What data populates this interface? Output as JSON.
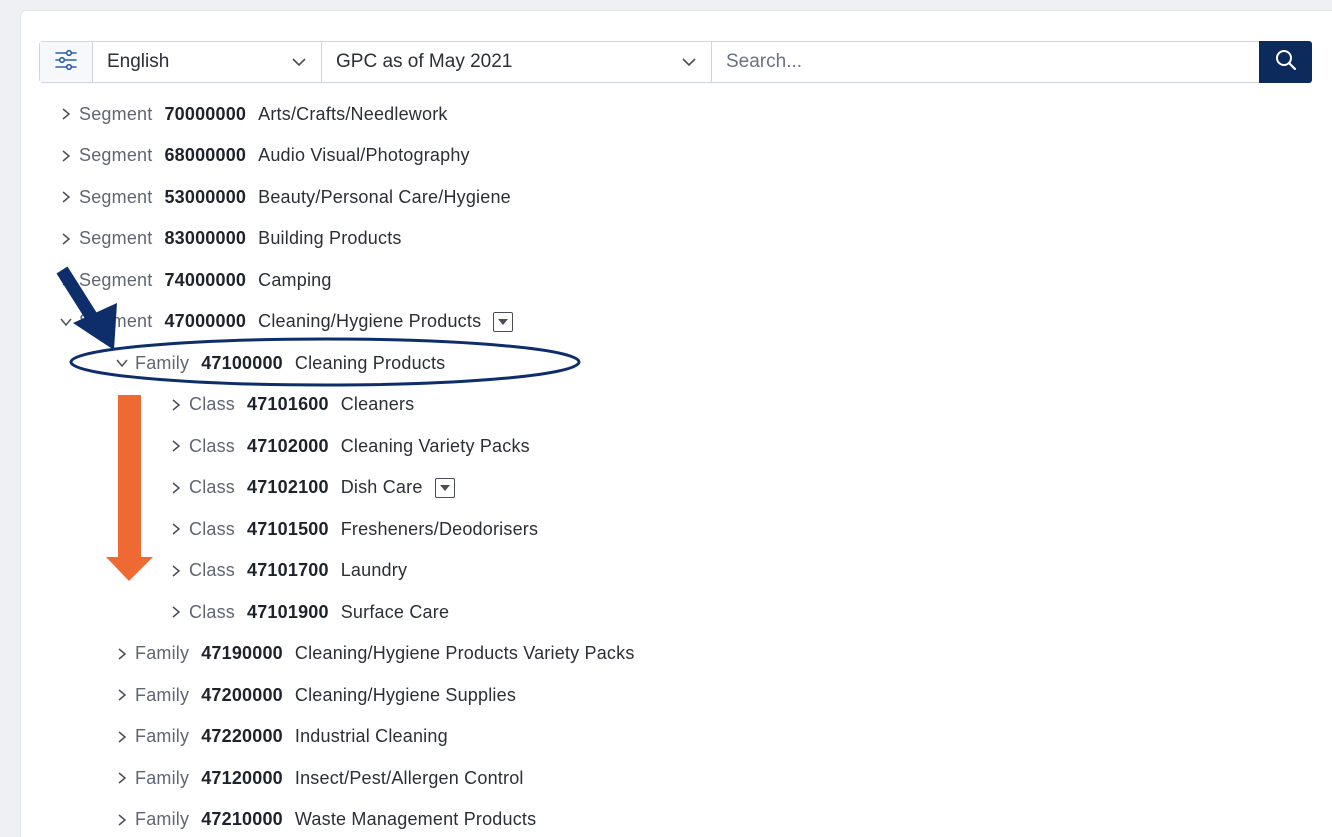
{
  "toolbar": {
    "filter_icon": "sliders-icon",
    "language": "English",
    "version": "GPC as of May 2021",
    "search_placeholder": "Search...",
    "search_icon": "search-icon"
  },
  "tree": [
    {
      "level": "Segment",
      "code": "70000000",
      "title": "Arts/Crafts/Needlework",
      "expanded": false,
      "dropdown": false
    },
    {
      "level": "Segment",
      "code": "68000000",
      "title": "Audio Visual/Photography",
      "expanded": false,
      "dropdown": false
    },
    {
      "level": "Segment",
      "code": "53000000",
      "title": "Beauty/Personal Care/Hygiene",
      "expanded": false,
      "dropdown": false
    },
    {
      "level": "Segment",
      "code": "83000000",
      "title": "Building Products",
      "expanded": false,
      "dropdown": false
    },
    {
      "level": "Segment",
      "code": "74000000",
      "title": "Camping",
      "expanded": false,
      "dropdown": false
    },
    {
      "level": "Segment",
      "code": "47000000",
      "title": "Cleaning/Hygiene Products",
      "expanded": true,
      "dropdown": true
    },
    {
      "level": "Family",
      "code": "47100000",
      "title": "Cleaning Products",
      "expanded": true,
      "dropdown": false
    },
    {
      "level": "Class",
      "code": "47101600",
      "title": "Cleaners",
      "expanded": false,
      "dropdown": false
    },
    {
      "level": "Class",
      "code": "47102000",
      "title": "Cleaning Variety Packs",
      "expanded": false,
      "dropdown": false
    },
    {
      "level": "Class",
      "code": "47102100",
      "title": "Dish Care",
      "expanded": false,
      "dropdown": true
    },
    {
      "level": "Class",
      "code": "47101500",
      "title": "Fresheners/Deodorisers",
      "expanded": false,
      "dropdown": false
    },
    {
      "level": "Class",
      "code": "47101700",
      "title": "Laundry",
      "expanded": false,
      "dropdown": false
    },
    {
      "level": "Class",
      "code": "47101900",
      "title": "Surface Care",
      "expanded": false,
      "dropdown": false
    },
    {
      "level": "Family",
      "code": "47190000",
      "title": "Cleaning/Hygiene Products Variety Packs",
      "expanded": false,
      "dropdown": false
    },
    {
      "level": "Family",
      "code": "47200000",
      "title": "Cleaning/Hygiene Supplies",
      "expanded": false,
      "dropdown": false
    },
    {
      "level": "Family",
      "code": "47220000",
      "title": "Industrial Cleaning",
      "expanded": false,
      "dropdown": false
    },
    {
      "level": "Family",
      "code": "47120000",
      "title": "Insect/Pest/Allergen Control",
      "expanded": false,
      "dropdown": false
    },
    {
      "level": "Family",
      "code": "47210000",
      "title": "Waste Management Products",
      "expanded": false,
      "dropdown": false
    }
  ],
  "annotations": {
    "arrow_navy_color": "#0e2e6b",
    "arrow_orange_color": "#ef6a33",
    "ellipse_color": "#0e2e6b"
  }
}
